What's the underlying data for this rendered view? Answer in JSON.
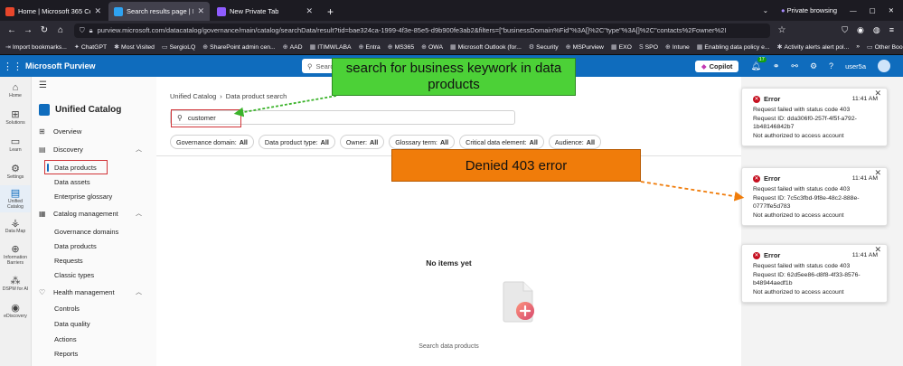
{
  "browser": {
    "tabs": [
      {
        "title": "Home | Microsoft 365 Copilot",
        "color": "#e8462b"
      },
      {
        "title": "Search results page | Microsoft",
        "color": "#2ea3f2",
        "active": true
      },
      {
        "title": "New Private Tab",
        "color": "#8f5cff"
      }
    ],
    "private_label": "Private browsing",
    "url": "purview.microsoft.com/datacatalog/governance/main/catalog/searchData/result?tid=bae324ca-1999-4f3e-85e5-d9b900fe3ab2&filters=[\"businessDomain%Fid\"%3A[]%2C\"type\"%3A[]%2C\"contacts%2Fowner%2I",
    "bookmarks": [
      {
        "label": "Import bookmarks...",
        "icon": "⇥"
      },
      {
        "label": "ChatGPT",
        "icon": "✦"
      },
      {
        "label": "Most Visited",
        "icon": "✱"
      },
      {
        "label": "SergioLQ",
        "icon": "▭"
      },
      {
        "label": "SharePoint admin cen...",
        "icon": "⊕"
      },
      {
        "label": "AAD",
        "icon": "⊕"
      },
      {
        "label": "ITIMWLABA",
        "icon": "▦"
      },
      {
        "label": "Entra",
        "icon": "⊕"
      },
      {
        "label": "MS365",
        "icon": "⊕"
      },
      {
        "label": "OWA",
        "icon": "⊕"
      },
      {
        "label": "Microsoft Outlook (for...",
        "icon": "▦"
      },
      {
        "label": "Security",
        "icon": "⚙"
      },
      {
        "label": "MSPurview",
        "icon": "⊕"
      },
      {
        "label": "EXO",
        "icon": "▦"
      },
      {
        "label": "SPO",
        "icon": "S"
      },
      {
        "label": "Intune",
        "icon": "⊕"
      },
      {
        "label": "Enabling data policy e...",
        "icon": "▦"
      },
      {
        "label": "Activity alerts alert pol...",
        "icon": "✱"
      }
    ],
    "other_bookmarks": "Other Bookmarks"
  },
  "app": {
    "name": "Microsoft Purview",
    "search_placeholder": "Search",
    "copilot_label": "Copilot",
    "notification_count": "17",
    "user": "user5a"
  },
  "rail": [
    {
      "label": "Home",
      "icon": "⌂"
    },
    {
      "label": "Solutions",
      "icon": "⊞"
    },
    {
      "label": "Learn",
      "icon": "▭"
    },
    {
      "label": "Settings",
      "icon": "⚙"
    },
    {
      "label": "Unified Catalog",
      "icon": "▤",
      "active": true
    },
    {
      "label": "Data Map",
      "icon": "⚶"
    },
    {
      "label": "Information Barriers",
      "icon": "⊕"
    },
    {
      "label": "DSPM for AI",
      "icon": "⁂"
    },
    {
      "label": "eDiscovery",
      "icon": "◉"
    }
  ],
  "sidenav": {
    "title": "Unified Catalog",
    "items": [
      {
        "label": "Overview",
        "icon": "⊞",
        "level": 0
      },
      {
        "label": "Discovery",
        "icon": "▤",
        "level": 0,
        "expandable": true
      },
      {
        "label": "Data products",
        "level": 1,
        "selected": true
      },
      {
        "label": "Data assets",
        "level": 1
      },
      {
        "label": "Enterprise glossary",
        "level": 1
      },
      {
        "label": "Catalog management",
        "icon": "▦",
        "level": 0,
        "expandable": true
      },
      {
        "label": "Governance domains",
        "level": 1
      },
      {
        "label": "Data products",
        "level": 1
      },
      {
        "label": "Requests",
        "level": 1
      },
      {
        "label": "Classic types",
        "level": 1
      },
      {
        "label": "Health management",
        "icon": "♡",
        "level": 0,
        "expandable": true
      },
      {
        "label": "Controls",
        "level": 1
      },
      {
        "label": "Data quality",
        "level": 1
      },
      {
        "label": "Actions",
        "level": 1
      },
      {
        "label": "Reports",
        "level": 1
      }
    ]
  },
  "main": {
    "breadcrumb": [
      "Unified Catalog",
      "Data product search"
    ],
    "search_value": "customer",
    "filters": [
      {
        "name": "Governance domain:",
        "value": "All"
      },
      {
        "name": "Data product type:",
        "value": "All"
      },
      {
        "name": "Owner:",
        "value": "All"
      },
      {
        "name": "Glossary term:",
        "value": "All"
      },
      {
        "name": "Critical data element:",
        "value": "All"
      },
      {
        "name": "Audience:",
        "value": "All"
      }
    ],
    "empty_title": "No items yet",
    "empty_sub": "Search data products"
  },
  "toasts": [
    {
      "title": "Error",
      "time": "11:41 AM",
      "line1": "Request failed with status code 403",
      "line2": "Request ID: dda306f0-257f-4f5f-a792-1b48146842b7",
      "line3": "Not authorized to access account"
    },
    {
      "title": "Error",
      "time": "11:41 AM",
      "line1": "Request failed with status code 403",
      "line2": "Request ID: 7c5c3fbd-9f8e-48c2-888e-0777ffe5d783",
      "line3": "Not authorized to access account"
    },
    {
      "title": "Error",
      "time": "11:41 AM",
      "line1": "Request failed with status code 403",
      "line2": "Request ID: 62d5ee86-d8f8-4f33-8576-b48944aedf1b",
      "line3": "Not authorized to access account"
    }
  ],
  "annotations": {
    "green": "search for business keywork in data products",
    "orange": "Denied 403 error",
    "green_color": "#4cd137",
    "orange_color": "#f07c0a"
  }
}
